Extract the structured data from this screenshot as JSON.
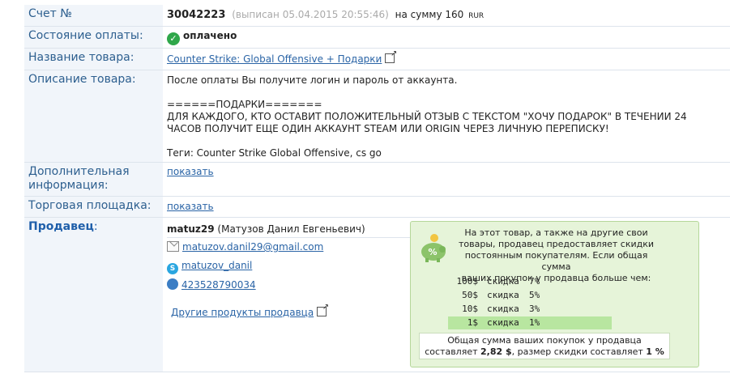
{
  "invoice": {
    "label": "Счет №",
    "number": "30042223",
    "issued": "(выписан 05.04.2015 20:55:46)",
    "amount_prefix": "на сумму 160",
    "currency": "RUR"
  },
  "payment": {
    "label": "Состояние оплаты:",
    "status": "оплачено"
  },
  "product": {
    "label": "Название товара:",
    "name": "Counter Strike: Global Offensive + Подарки"
  },
  "description": {
    "label": "Описание товара:",
    "line1": "После оплаты Вы получите логин и пароль от аккаунта.",
    "line2": "======ПОДАРКИ=======",
    "line3": "ДЛЯ КАЖДОГО, КТО ОСТАВИТ ПОЛОЖИТЕЛЬНЫЙ ОТЗЫВ С ТЕКСТОМ \"ХОЧУ ПОДАРОК\" В ТЕЧЕНИИ 24",
    "line4": "ЧАСОВ ПОЛУЧИТ ЕЩЕ ОДИН АККАУНТ STEAM ИЛИ ORIGIN ЧЕРЕЗ ЛИЧНУЮ ПЕРЕПИСКУ!",
    "line5": "Теги: Counter Strike Global Offensive, cs go"
  },
  "extra": {
    "label_line1": "Дополнительная",
    "label_line2": "информация:",
    "link": "показать"
  },
  "marketplace": {
    "label": "Торговая площадка:",
    "link": "показать"
  },
  "seller": {
    "label": "Продавец",
    "colon": ":",
    "nick": "matuz29",
    "fullname": "(Матузов Данил Евгеньевич)",
    "email": "matuzov.danil29@gmail.com",
    "skype": "matuzov_danil",
    "icq": "423528790034",
    "other_products": "Другие продукты продавца"
  },
  "discount": {
    "text_line1": "На этот товар, а также на другие свои",
    "text_line2": "товары, продавец предоставляет скидки",
    "text_line3": "постоянным покупателям. Если общая сумма",
    "text_line4": "ваших покупок у продавца больше чем:",
    "tiers": [
      {
        "amount": "100$",
        "word": "скидка",
        "percent": "7%"
      },
      {
        "amount": "50$",
        "word": "скидка",
        "percent": "5%"
      },
      {
        "amount": "10$",
        "word": "скидка",
        "percent": "3%"
      },
      {
        "amount": "1$",
        "word": "скидка",
        "percent": "1%"
      }
    ],
    "active_tier": 3,
    "total_line1": "Общая сумма ваших покупок у продавца",
    "total_prefix": "составляет",
    "total_value": "2,82 $",
    "total_middle": ", размер скидки составляет",
    "total_percent": "1 %"
  },
  "colors": {
    "accent": "#2a64a6",
    "label_bg": "#f1f5fa",
    "discount_bg": "#e6f4d9",
    "active_tier": "#b8e6a0",
    "paid_green": "#2fa74a"
  }
}
